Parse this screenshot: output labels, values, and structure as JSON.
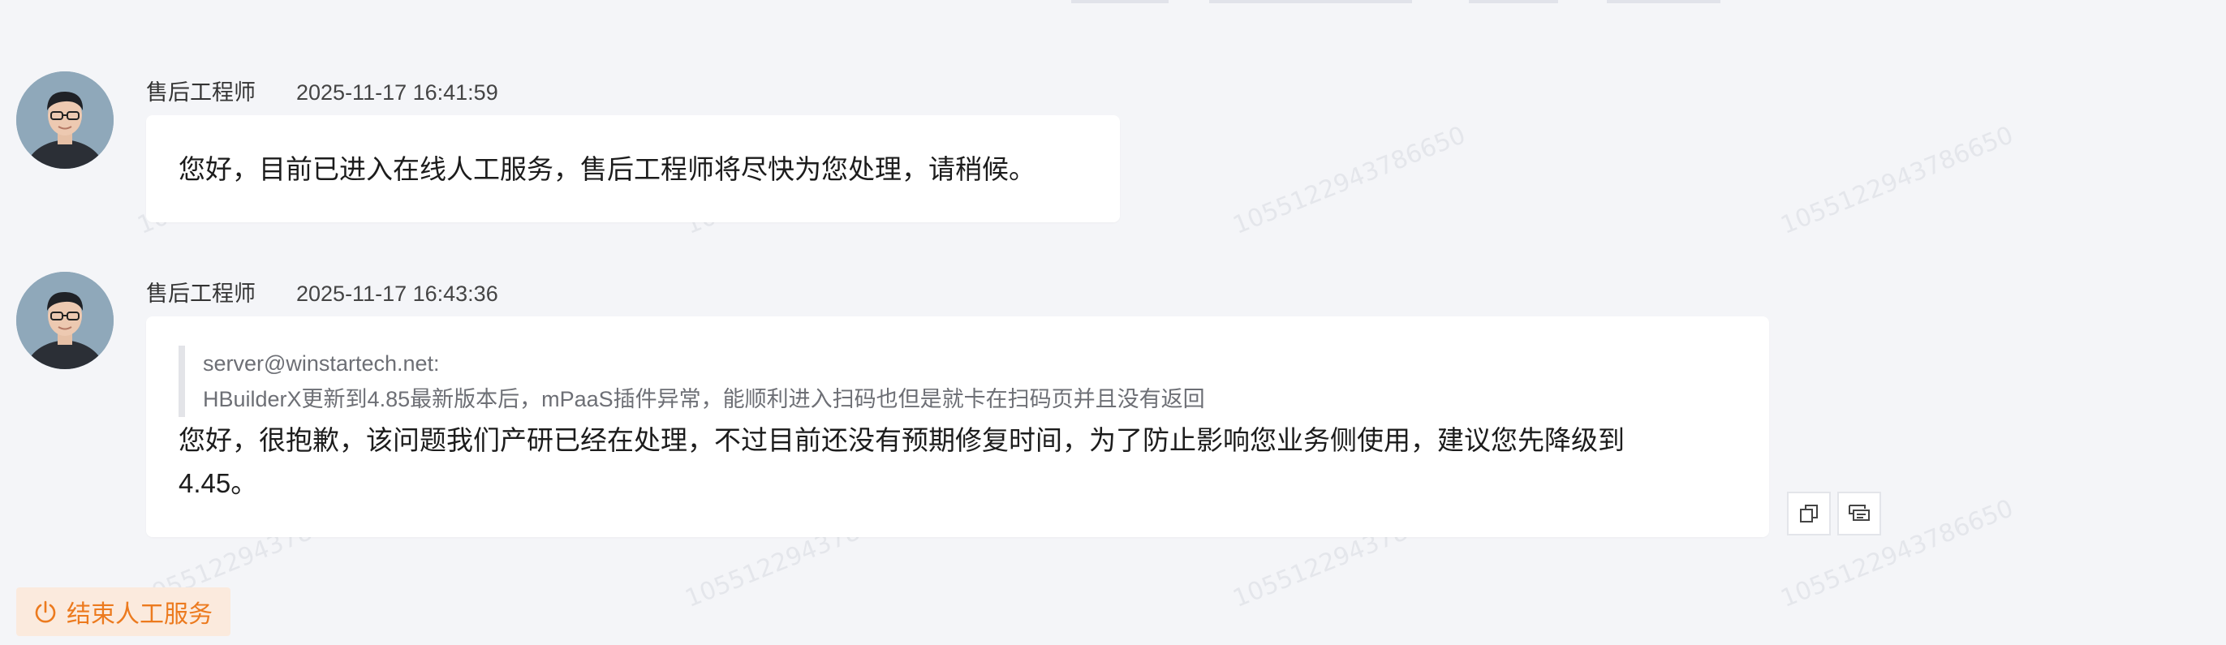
{
  "watermark_text": "1055122943786650",
  "messages": [
    {
      "sender": "售后工程师",
      "time": "2025-11-17 16:41:59",
      "text": "您好，目前已进入在线人工服务，售后工程师将尽快为您处理，请稍候。"
    },
    {
      "sender": "售后工程师",
      "time": "2025-11-17 16:43:36",
      "quote_author": "server@winstartech.net:",
      "quote_text": "HBuilderX更新到4.85最新版本后，mPaaS插件异常，能顺利进入扫码也但是就卡在扫码页并且没有返回",
      "text_line1": "您好，很抱歉，该问题我们产研已经在处理，不过目前还没有预期修复时间，为了防止影响您业务侧使用，建议您先降级到",
      "text_line2": "4.45。"
    }
  ],
  "actions": {
    "copy_icon": "copy-icon",
    "quote_icon": "quote-reply-icon",
    "end_service_label": "结束人工服务",
    "end_service_icon": "power-icon"
  },
  "colors": {
    "background": "#f4f5f8",
    "bubble": "#ffffff",
    "accent_orange": "#ec7a1e",
    "end_button_bg": "#fbeadd"
  }
}
